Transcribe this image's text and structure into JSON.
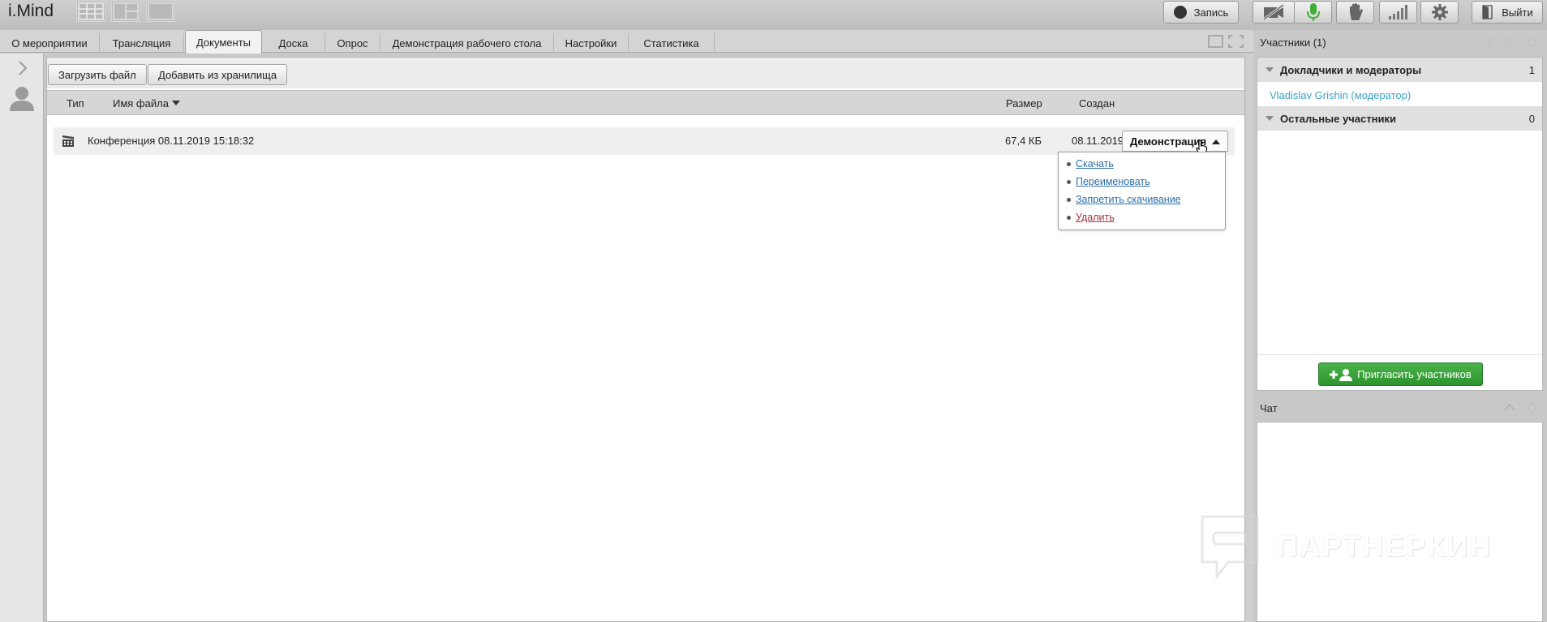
{
  "app": {
    "logo": "i.Mind"
  },
  "toolbar": {
    "record_label": "Запись",
    "exit_label": "Выйти",
    "icons": [
      "grid-layout-icon",
      "split-layout-icon",
      "single-layout-icon",
      "camera-off-icon",
      "microphone-icon",
      "raise-hand-icon",
      "signal-icon",
      "gear-icon",
      "exit-door-icon"
    ],
    "mic_color": "#3fae3a"
  },
  "tabs": [
    {
      "label": "О мероприятии",
      "active": false
    },
    {
      "label": "Трансляция",
      "active": false
    },
    {
      "label": "Документы",
      "active": true
    },
    {
      "label": "Доска",
      "active": false
    },
    {
      "label": "Опрос",
      "active": false
    },
    {
      "label": "Демонстрация рабочего стола",
      "active": false
    },
    {
      "label": "Настройки",
      "active": false
    },
    {
      "label": "Статистика",
      "active": false
    }
  ],
  "documents": {
    "upload_label": "Загрузить файл",
    "add_from_storage_label": "Добавить из хранилища",
    "columns": {
      "type": "Тип",
      "name": "Имя файла",
      "size": "Размер",
      "created": "Создан"
    },
    "rows": [
      {
        "icon": "film-clapper-icon",
        "name": "Конференция 08.11.2019 15:18:32",
        "size": "67,4 КБ",
        "created": "08.11.2019"
      }
    ],
    "action_button_label": "Демонстрация",
    "menu": [
      {
        "label": "Скачать",
        "danger": false
      },
      {
        "label": "Переименовать",
        "danger": false
      },
      {
        "label": "Запретить скачивание",
        "danger": false
      },
      {
        "label": "Удалить",
        "danger": true
      }
    ]
  },
  "participants": {
    "title": "Участники (1)",
    "groups": [
      {
        "name": "Докладчики и модераторы",
        "count": "1"
      },
      {
        "name": "Остальные участники",
        "count": "0"
      }
    ],
    "members": [
      {
        "name": "Vladislav Grishin (модератор)"
      }
    ],
    "invite_label": "Пригласить участников",
    "invite_color": "#3aa53a"
  },
  "chat": {
    "title": "Чат"
  },
  "watermark": {
    "text": "ПАРТНЕРКИН"
  }
}
